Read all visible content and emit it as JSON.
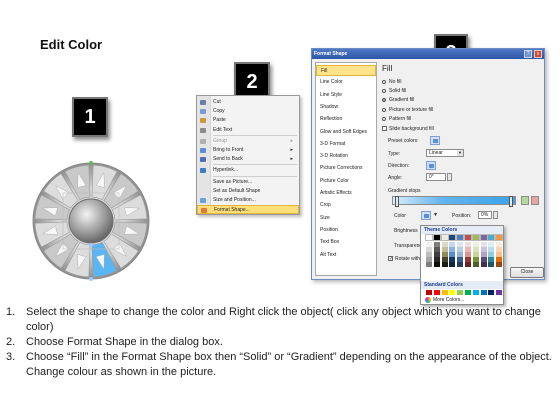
{
  "slide": {
    "title": "Edit Color",
    "step_badges": [
      "1",
      "2",
      "3"
    ]
  },
  "context_menu": {
    "items": [
      {
        "label": "Cut",
        "icon": "scissors-icon",
        "disabled": false,
        "submenu": false
      },
      {
        "label": "Copy",
        "icon": "copy-icon",
        "disabled": false,
        "submenu": false
      },
      {
        "label": "Paste",
        "icon": "paste-icon",
        "disabled": false,
        "submenu": false
      },
      {
        "label": "Edit Text",
        "icon": "edit-text-icon",
        "disabled": false,
        "submenu": false
      },
      {
        "label": "Group",
        "icon": "group-icon",
        "disabled": true,
        "submenu": true
      },
      {
        "label": "Bring to Front",
        "icon": "bring-front-icon",
        "disabled": false,
        "submenu": true
      },
      {
        "label": "Send to Back",
        "icon": "send-back-icon",
        "disabled": false,
        "submenu": true
      },
      {
        "label": "Hyperlink...",
        "icon": "hyperlink-icon",
        "disabled": false,
        "submenu": false
      },
      {
        "label": "Save as Picture...",
        "icon": "",
        "disabled": false,
        "submenu": false
      },
      {
        "label": "Set as Default Shape",
        "icon": "",
        "disabled": false,
        "submenu": false
      },
      {
        "label": "Size and Position...",
        "icon": "size-icon",
        "disabled": false,
        "submenu": false
      },
      {
        "label": "Format Shape...",
        "icon": "format-shape-icon",
        "disabled": false,
        "submenu": false,
        "highlighted": true
      }
    ]
  },
  "format_dialog": {
    "title": "Format Shape",
    "help_label": "?",
    "close_label": "x",
    "nav": [
      "Fill",
      "Line Color",
      "Line Style",
      "Shadow",
      "Reflection",
      "Glow and Soft Edges",
      "3-D Format",
      "3-D Rotation",
      "Picture Corrections",
      "Picture Color",
      "Artistic Effects",
      "Crop",
      "Size",
      "Position",
      "Text Box",
      "Alt Text"
    ],
    "selected_nav": "Fill",
    "pane_title": "Fill",
    "fill_options": [
      {
        "label": "No fill",
        "selected": false
      },
      {
        "label": "Solid fill",
        "selected": false
      },
      {
        "label": "Gradient fill",
        "selected": true
      },
      {
        "label": "Picture or texture fill",
        "selected": false
      },
      {
        "label": "Pattern fill",
        "selected": false
      }
    ],
    "slide_background_label": "Slide background fill",
    "preset_colors_label": "Preset colors:",
    "type_label": "Type:",
    "type_value": "Linear",
    "direction_label": "Direction:",
    "angle_label": "Angle:",
    "angle_value": "0°",
    "gradient_stops_label": "Gradient stops",
    "color_label": "Color",
    "position_label": "Position:",
    "position_value": "0%",
    "brightness_label": "Brightness",
    "transparency_label": "Transparency",
    "rotate_label": "Rotate with shape",
    "close_button": "Close"
  },
  "color_picker": {
    "theme_header": "Theme Colors",
    "standard_header": "Standard Colors",
    "more_colors": "More Colors...",
    "theme_top_row": [
      "#ffffff",
      "#000000",
      "#eeece1",
      "#1f497d",
      "#4f81bd",
      "#c0504d",
      "#9bbb59",
      "#8064a2",
      "#4bacc6",
      "#f79646"
    ],
    "theme_shades": [
      [
        "#f2f2f2",
        "#7f7f7f",
        "#ddd9c3",
        "#c6d9f0",
        "#dbe5f1",
        "#f2dcdb",
        "#ebf1dd",
        "#e5e0ec",
        "#dbeef3",
        "#fdeada"
      ],
      [
        "#d8d8d8",
        "#595959",
        "#c4bd97",
        "#8db3e2",
        "#b8cce4",
        "#e5b9b7",
        "#d7e3bc",
        "#ccc1d9",
        "#b7dde8",
        "#fbd5b5"
      ],
      [
        "#bfbfbf",
        "#3f3f3f",
        "#938953",
        "#548dd4",
        "#95b3d7",
        "#d99694",
        "#c3d69b",
        "#b2a2c7",
        "#92cddc",
        "#fac08f"
      ],
      [
        "#a5a5a5",
        "#262626",
        "#494429",
        "#17365d",
        "#366092",
        "#953734",
        "#76923c",
        "#5f497a",
        "#31859b",
        "#e36c09"
      ],
      [
        "#7f7f7f",
        "#0c0c0c",
        "#1d1b10",
        "#0f243e",
        "#244061",
        "#632423",
        "#4f6128",
        "#3f3151",
        "#205867",
        "#974806"
      ]
    ],
    "standard_colors": [
      "#c00000",
      "#ff0000",
      "#ffc000",
      "#ffff00",
      "#92d050",
      "#00b050",
      "#00b0f0",
      "#0070c0",
      "#002060",
      "#7030a0"
    ]
  },
  "instructions": [
    {
      "num": "1.",
      "text": "Select the shape to change the color and Right click the object( click any object which you want to change color)"
    },
    {
      "num": "2.",
      "text": "Choose Format Shape in the dialog box."
    },
    {
      "num": "3.",
      "text": "Choose “Fill” in the Format Shape box then “Solid” or “Gradient” depending on the appearance of the object. Change colour as shown in the picture."
    }
  ],
  "colors": {
    "wheel_highlight": "#59b5f4",
    "menu_highlight": "#ffdf7a",
    "dialog_title": "#2c56a7"
  }
}
